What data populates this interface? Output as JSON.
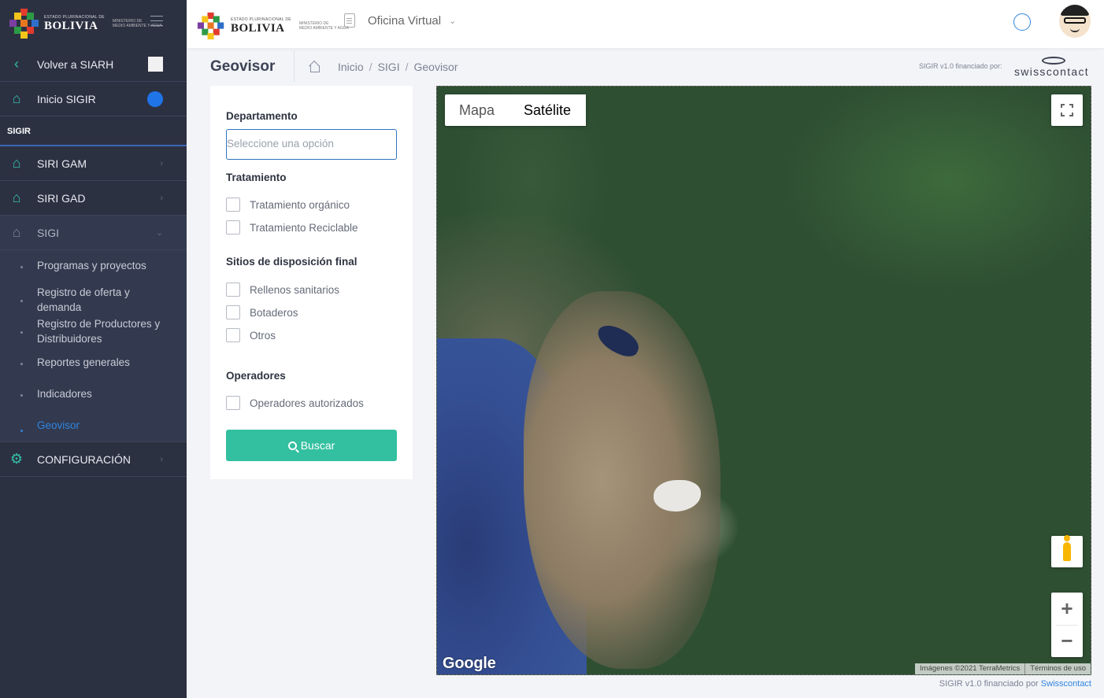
{
  "brand": {
    "state_label": "ESTADO PLURINACIONAL DE",
    "country": "BOLIVIA",
    "ministry_line1": "MINISTERIO DE",
    "ministry_line2": "MEDIO AMBIENTE Y AGUA"
  },
  "sidebar": {
    "back": {
      "label": "Volver a SIARH",
      "icon": "chevron-left-icon"
    },
    "home": {
      "label": "Inicio SIGIR",
      "icon": "home-icon"
    },
    "section": "SIGIR",
    "items": [
      {
        "label": "SIRI GAM",
        "icon": "home-outline-icon"
      },
      {
        "label": "SIRI GAD",
        "icon": "home-outline-icon"
      },
      {
        "label": "SIGI",
        "icon": "home-outline-icon"
      }
    ],
    "submenu": [
      "Programas y proyectos",
      "Registro de oferta y demanda",
      "Registro de Productores y Distribuidores",
      "Reportes generales",
      "Indicadores",
      "Geovisor"
    ],
    "active_submenu": "Geovisor",
    "config": {
      "label": "CONFIGURACIÓN",
      "icon": "gear-icon"
    }
  },
  "header": {
    "app_label": "Oficina Virtual",
    "network_icon": "network-icon",
    "avatar_icon": "user-avatar-icon"
  },
  "page": {
    "title": "Geovisor",
    "breadcrumb": [
      "Inicio",
      "SIGI",
      "Geovisor"
    ],
    "financed_label": "SIGIR v1.0 financiado por:",
    "sponsor": "swisscontact"
  },
  "filters": {
    "departamento_label": "Departamento",
    "departamento_placeholder": "Seleccione una opción",
    "tratamiento_label": "Tratamiento",
    "tratamiento_options": [
      "Tratamiento orgánico",
      "Tratamiento Reciclable"
    ],
    "sitios_label": "Sitios de disposición final",
    "sitios_options": [
      "Rellenos sanitarios",
      "Botaderos",
      "Otros"
    ],
    "operadores_label": "Operadores",
    "operadores_options": [
      "Operadores autorizados"
    ],
    "search_button": "Buscar"
  },
  "map": {
    "type_map": "Mapa",
    "type_satellite": "Satélite",
    "selected_type": "Satélite",
    "provider": "Google",
    "imagery_credit": "Imágenes ©2021 TerraMetrics",
    "terms": "Términos de uso"
  },
  "footer": {
    "text": "SIGIR v1.0 financiado por",
    "link": "Swisscontact"
  },
  "colors": {
    "sidebar_bg": "#2c3142",
    "accent_teal": "#33c0a0",
    "accent_blue": "#2f84e0"
  }
}
